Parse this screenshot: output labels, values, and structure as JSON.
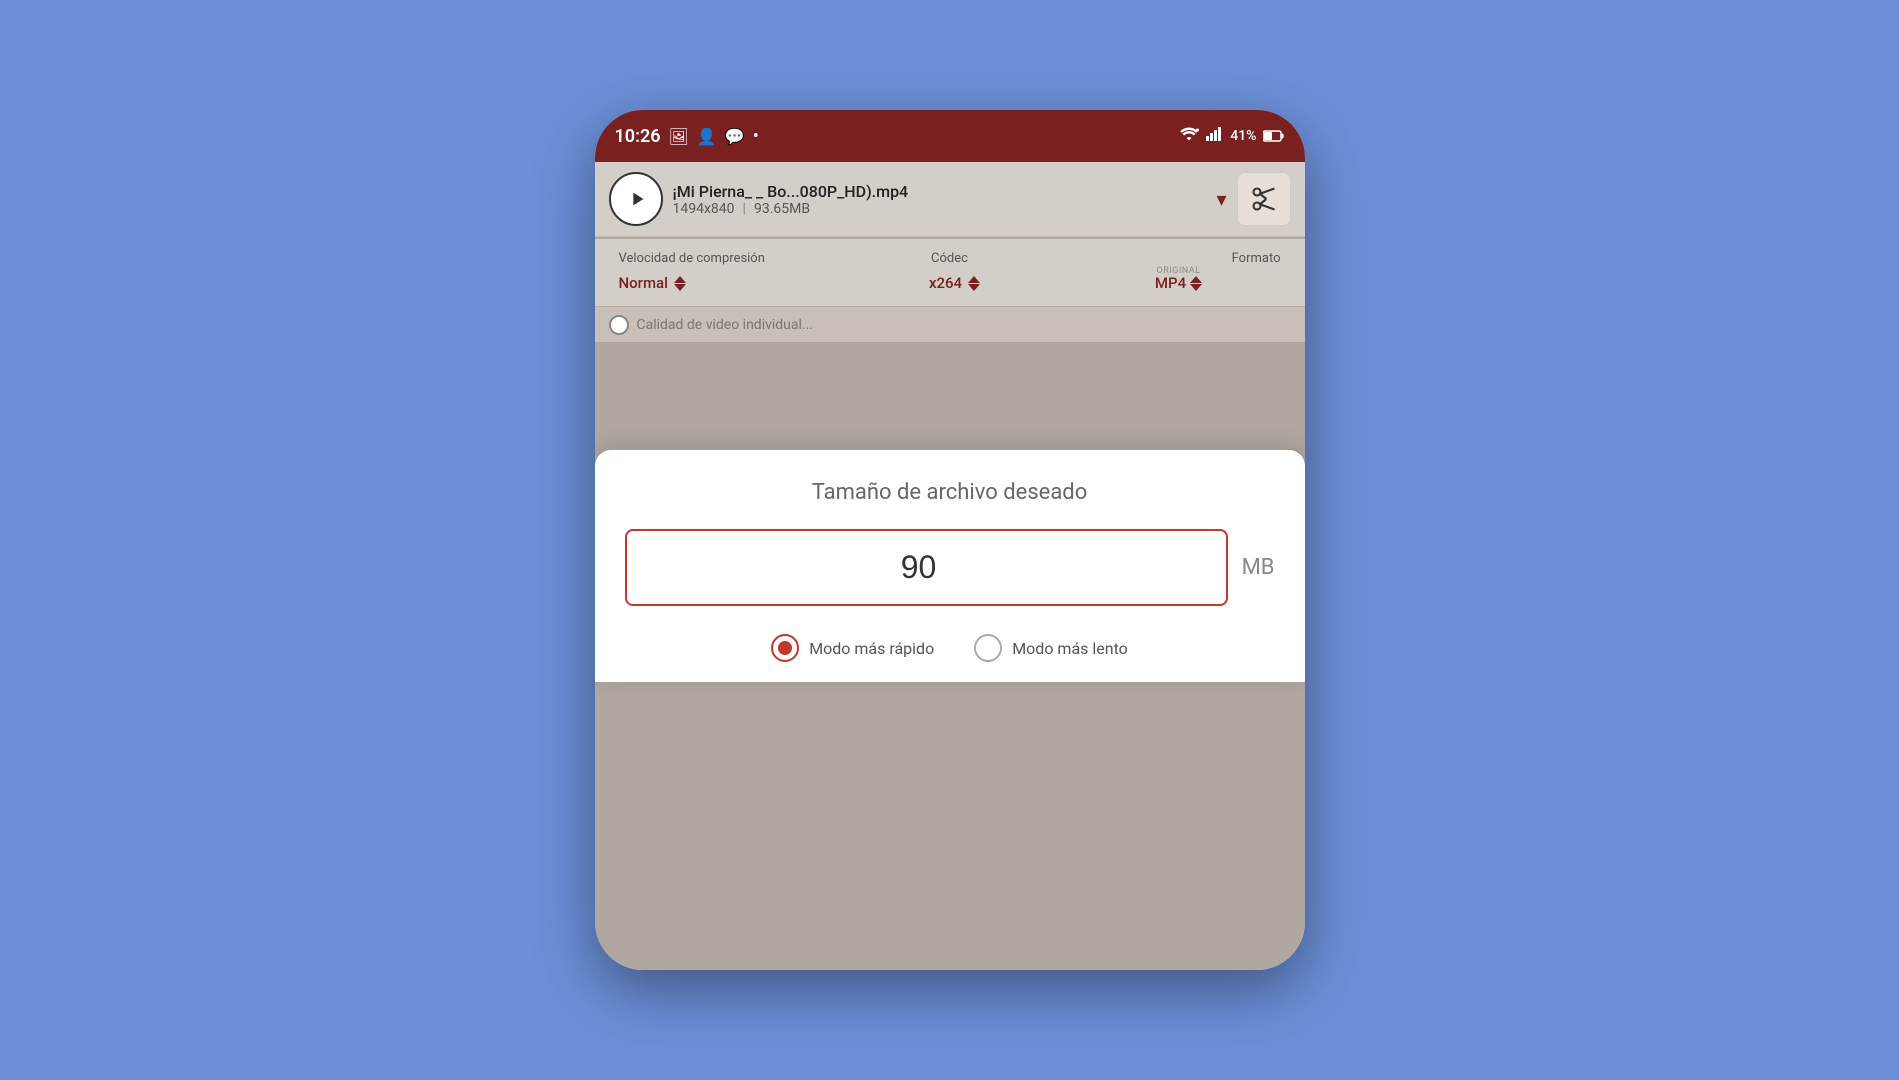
{
  "phone": {
    "status_bar": {
      "time": "10:26",
      "battery": "41%",
      "notifications": [
        "image",
        "user",
        "messenger",
        "dot"
      ]
    },
    "video_bar": {
      "file_name": "¡Mi Pierna_ _ Bo...080P_HD).mp4",
      "resolution": "1494x840",
      "file_size": "93.65MB",
      "play_label": "play",
      "scissors_label": "trim"
    },
    "compression_bar": {
      "speed_label": "Velocidad de compresión",
      "codec_label": "Códec",
      "format_label": "Formato",
      "speed_value": "Normal",
      "codec_value": "x264",
      "format_value": "MP4",
      "format_badge": "ORIGINAL"
    },
    "partial_row": {
      "text": "Calidad de video individual"
    },
    "dialog": {
      "title": "Tamaño de archivo deseado",
      "file_size_value": "90",
      "file_size_unit": "MB",
      "mode_fast_label": "Modo más rápido",
      "mode_slow_label": "Modo más lento",
      "mode_fast_selected": true,
      "mode_slow_selected": false
    }
  },
  "colors": {
    "accent": "#7a2020",
    "background": "#6b8fd8",
    "dialog_border": "#c0392b",
    "radio_selected": "#c0392b"
  }
}
